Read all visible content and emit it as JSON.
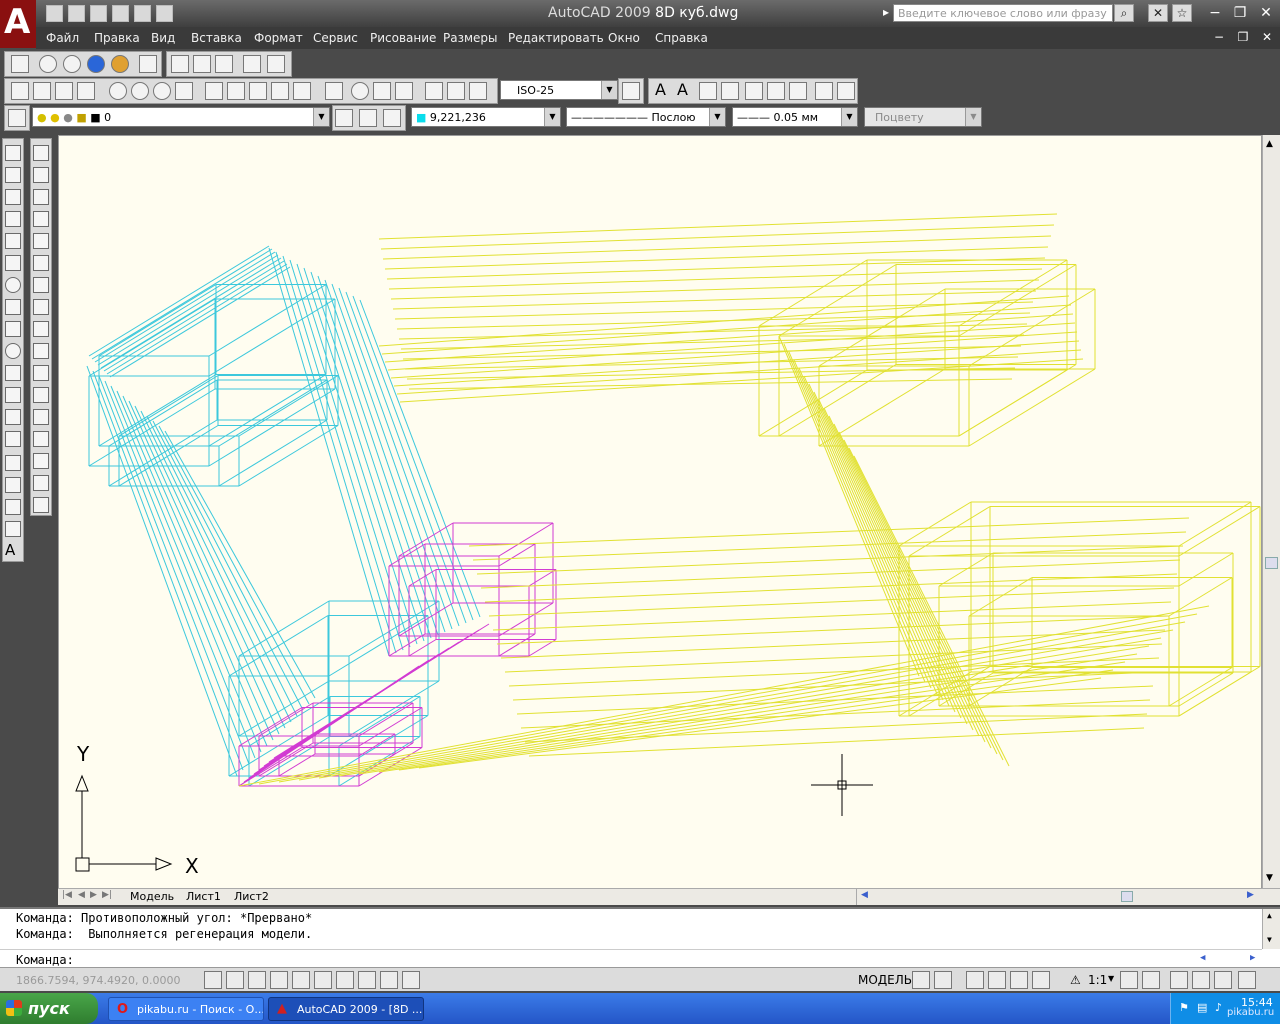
{
  "window": {
    "app_name": "AutoCAD 2009",
    "file_name": "8D куб.dwg",
    "search_placeholder": "Введите ключевое слово или фразу"
  },
  "menu": [
    "Файл",
    "Правка",
    "Вид",
    "Вставка",
    "Формат",
    "Сервис",
    "Рисование",
    "Размеры",
    "Редактировать",
    "Окно",
    "Справка"
  ],
  "toolbars": {
    "dimstyle": "ISO-25",
    "layer": "0",
    "color": "9,221,236",
    "linetype": "Послою",
    "lineweight": "0.05 мм",
    "plotstyle": "Поцвету"
  },
  "colors": {
    "cyan": "#3cc8dc",
    "magenta": "#d23cd2",
    "yellow": "#e1e132",
    "canvas": "#fffdf0"
  },
  "ucs": {
    "x_label": "X",
    "y_label": "Y"
  },
  "tabs": [
    "Модель",
    "Лист1",
    "Лист2"
  ],
  "command_history": [
    "Команда: Противоположный угол: *Прервано*",
    "Команда:  Выполняется регенерация модели."
  ],
  "command_prompt": "Команда:",
  "status": {
    "coordinates": "1866.7594, 974.4920, 0.0000",
    "model_label": "МОДЕЛЬ",
    "scale": "1:1"
  },
  "taskbar": {
    "start_label": "пуск",
    "tasks": [
      "pikabu.ru - Поиск - О...",
      "AutoCAD 2009 - [8D ..."
    ],
    "clock": "15:44",
    "watermark": "pikabu.ru"
  }
}
